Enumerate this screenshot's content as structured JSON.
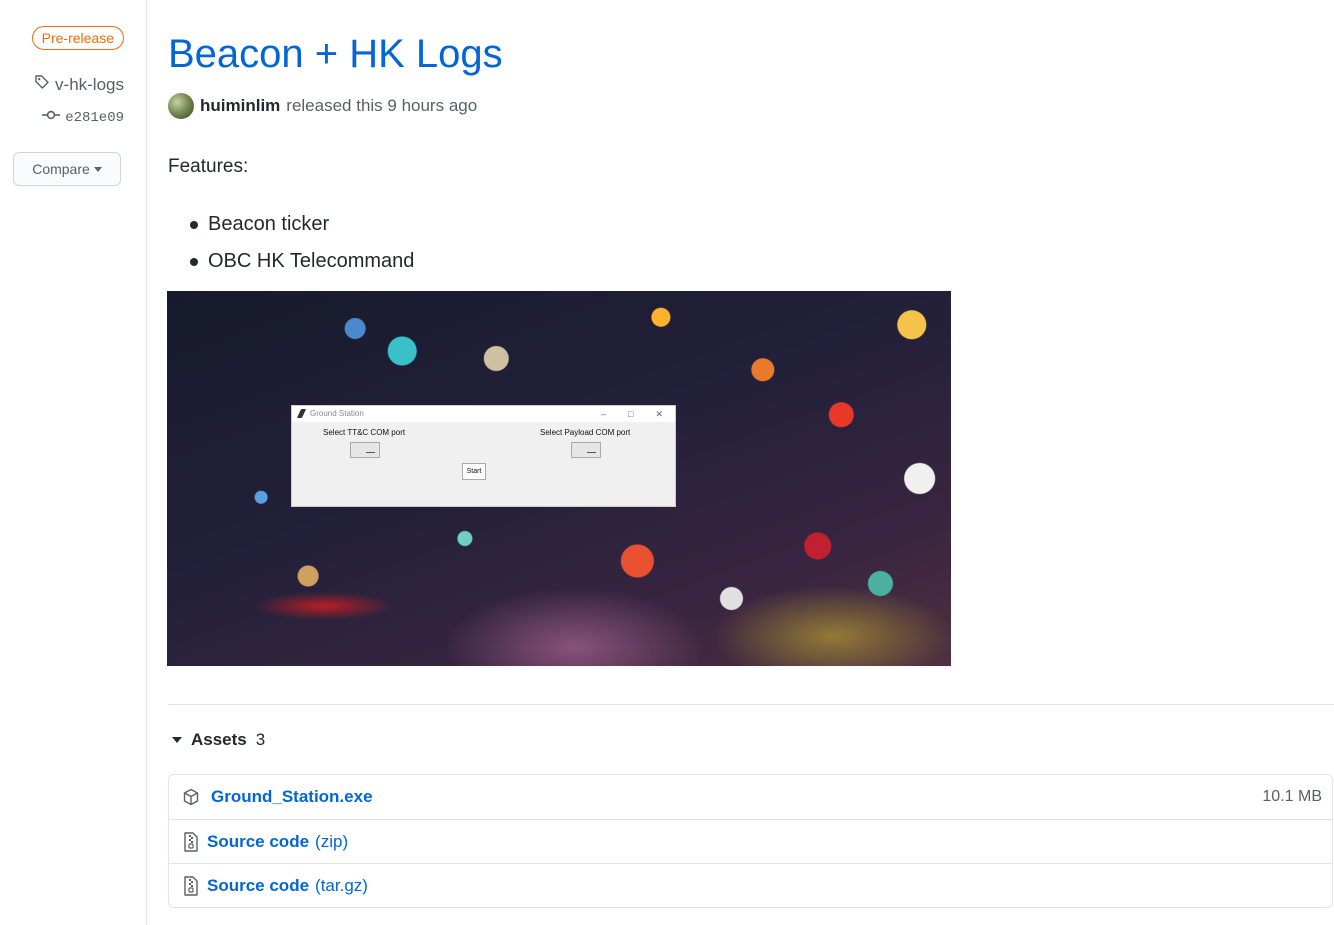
{
  "sidebar": {
    "prerelease_label": "Pre-release",
    "tag": "v-hk-logs",
    "commit": "e281e09",
    "compare_label": "Compare"
  },
  "release": {
    "title": "Beacon + HK Logs",
    "author": "huiminlim",
    "released_text": "released this 9 hours ago",
    "features_label": "Features:",
    "features": [
      "Beacon ticker",
      "OBC HK Telecommand"
    ]
  },
  "preview_window": {
    "title": "Ground Station",
    "left_label": "Select TT&C COM port",
    "right_label": "Select Payload COM port",
    "start_label": "Start"
  },
  "assets": {
    "label": "Assets",
    "count": "3",
    "items": [
      {
        "name": "Ground_Station.exe",
        "suffix": "",
        "size": "10.1 MB",
        "icon": "package-icon"
      },
      {
        "name": "Source code",
        "suffix": "(zip)",
        "size": "",
        "icon": "file-zip-icon"
      },
      {
        "name": "Source code",
        "suffix": "(tar.gz)",
        "size": "",
        "icon": "file-zip-icon"
      }
    ]
  },
  "colors": {
    "link": "#0366d6",
    "prerelease": "#f66a0a",
    "muted": "#586069",
    "border": "#e1e4e8"
  }
}
